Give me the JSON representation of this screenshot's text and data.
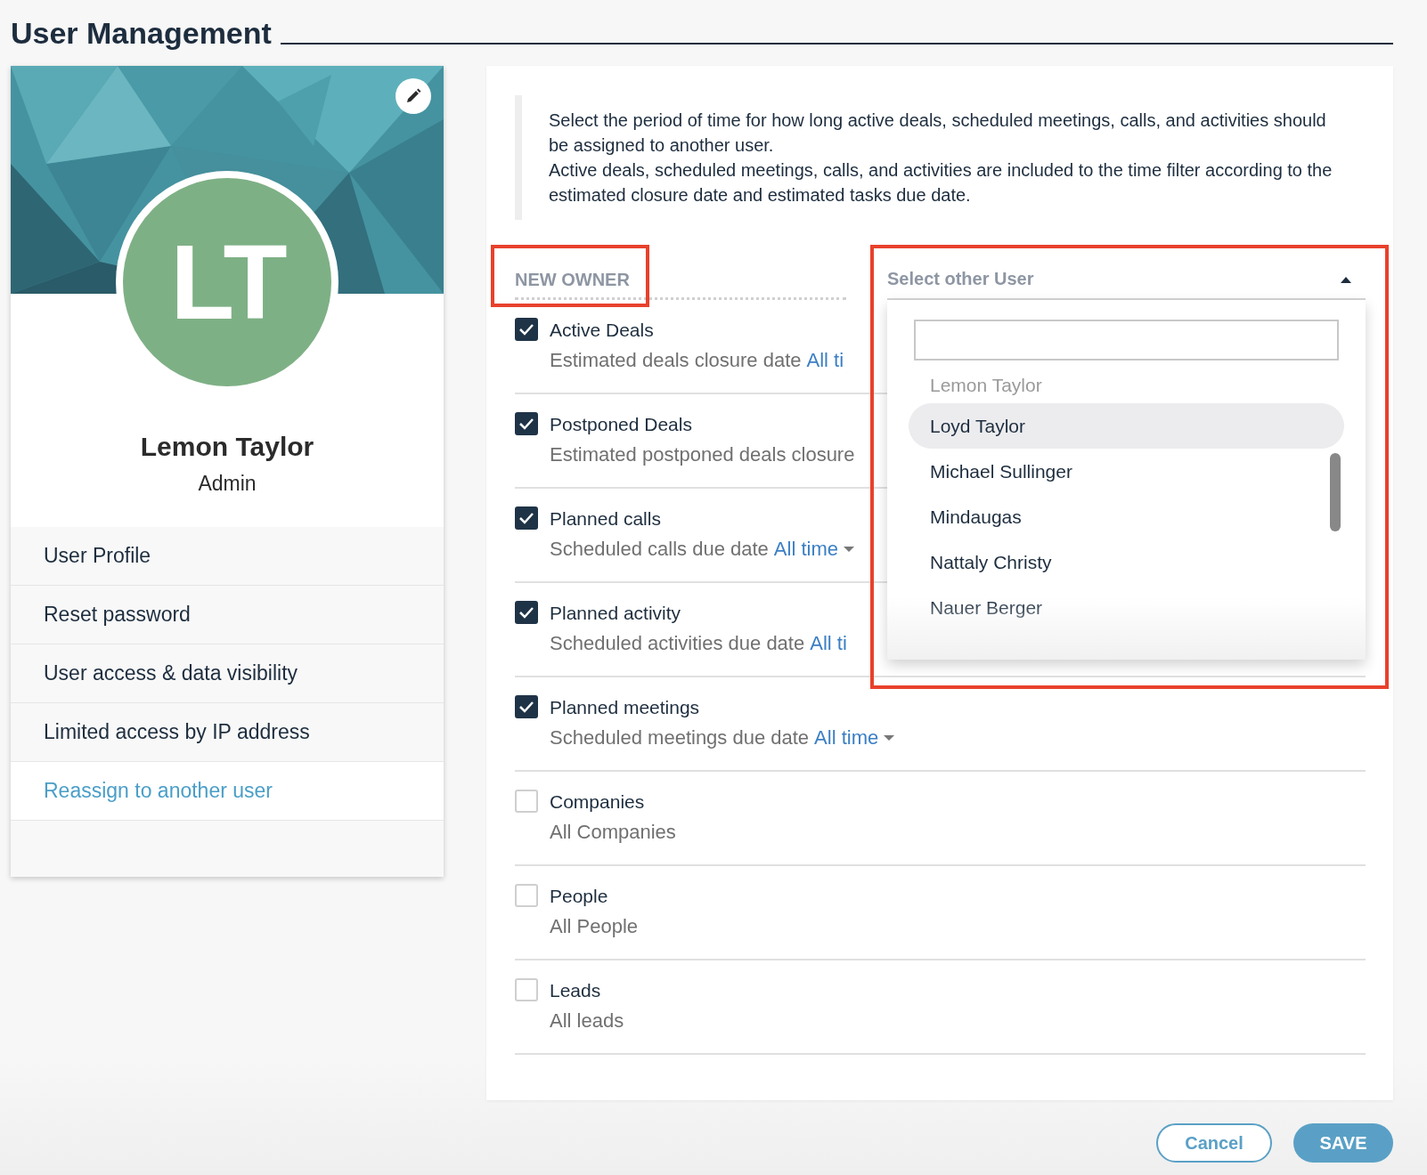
{
  "title": "User Management",
  "profile": {
    "initials": "LT",
    "name": "Lemon Taylor",
    "role": "Admin"
  },
  "menu": [
    {
      "label": "User Profile",
      "selected": false
    },
    {
      "label": "Reset password",
      "selected": false
    },
    {
      "label": "User access & data visibility",
      "selected": false
    },
    {
      "label": "Limited access by IP address",
      "selected": false
    },
    {
      "label": "Reassign to another user",
      "selected": true
    }
  ],
  "description": [
    "Select the period of time for how long active deals, scheduled meetings, calls, and activities should be assigned to another user.",
    "Active deals, scheduled meetings, calls, and activities are included to the time filter according to the estimated closure date and estimated tasks due date."
  ],
  "new_owner": {
    "label": "NEW OWNER",
    "placeholder": "Select other User",
    "expanded": true
  },
  "options": [
    {
      "label": "Lemon Taylor",
      "disabled": true,
      "selected": false
    },
    {
      "label": "Loyd Taylor",
      "disabled": false,
      "selected": true
    },
    {
      "label": "Michael Sullinger",
      "disabled": false,
      "selected": false
    },
    {
      "label": "Mindaugas",
      "disabled": false,
      "selected": false
    },
    {
      "label": "Nattaly Christy",
      "disabled": false,
      "selected": false
    },
    {
      "label": "Nauer Berger",
      "disabled": false,
      "selected": false
    }
  ],
  "items": [
    {
      "label": "Active Deals",
      "checked": true,
      "detail": "Estimated deals closure date",
      "period": "All ti",
      "period_menu": false
    },
    {
      "label": "Postponed Deals",
      "checked": true,
      "detail": "Estimated postponed deals closure",
      "period_menu": false
    },
    {
      "label": "Planned calls",
      "checked": true,
      "detail": "Scheduled calls due date",
      "period": "All time",
      "period_menu": true
    },
    {
      "label": "Planned activity",
      "checked": true,
      "detail": "Scheduled activities due date",
      "period": "All ti",
      "period_menu": false
    },
    {
      "label": "Planned meetings",
      "checked": true,
      "detail": "Scheduled meetings due date",
      "period": "All time",
      "period_menu": true
    },
    {
      "label": "Companies",
      "checked": false,
      "detail": "All Companies",
      "period_menu": false
    },
    {
      "label": "People",
      "checked": false,
      "detail": "All People",
      "period_menu": false
    },
    {
      "label": "Leads",
      "checked": false,
      "detail": "All leads",
      "period_menu": false
    }
  ],
  "buttons": {
    "cancel": "Cancel",
    "save": "SAVE"
  }
}
